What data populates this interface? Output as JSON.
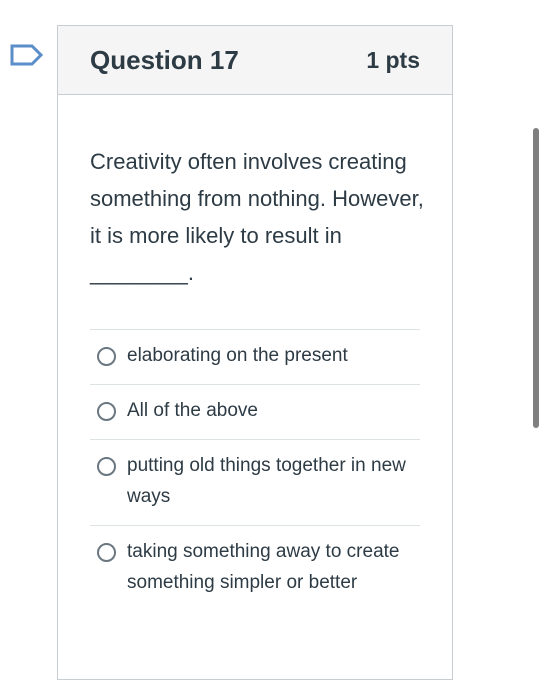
{
  "question": {
    "title": "Question 17",
    "points": "1 pts",
    "text": "Creativity often involves creating something from nothing. However, it is more likely to result in ________.",
    "answers": [
      {
        "label": "elaborating on the present",
        "selected": false
      },
      {
        "label": "All of the above",
        "selected": false
      },
      {
        "label": "putting old things together in new ways",
        "selected": false
      },
      {
        "label": "taking something away to create something simpler or better",
        "selected": false
      }
    ]
  },
  "icons": {
    "flag": "flag-outline-icon",
    "radio": "radio-unchecked-icon"
  },
  "colors": {
    "flag_stroke": "#5b8dc9",
    "header_bg": "#f5f5f5",
    "border": "#c7cdd1",
    "text": "#2d3b45",
    "scrollbar": "#7f7f7f"
  }
}
